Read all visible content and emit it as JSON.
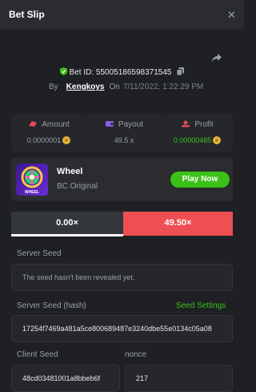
{
  "header": {
    "title": "Bet Slip",
    "close_icon": "close-icon"
  },
  "bet": {
    "id_label": "Bet ID: 5500518659837154​5",
    "by_label": "By",
    "username": "Kengkoys",
    "on_label": "On",
    "date": "7/11/2022, 1:22:29 PM"
  },
  "stats": [
    {
      "label": "Amount",
      "value": "0.0000001",
      "icon": "money-icon",
      "color": "#e24a5c"
    },
    {
      "label": "Payout",
      "value": "49.5 x",
      "icon": "wallet-icon",
      "color": "#8c5ce0"
    },
    {
      "label": "Profit",
      "value": "0.00000485",
      "icon": "profit-icon",
      "color": "#e24a5c"
    }
  ],
  "game": {
    "name": "Wheel",
    "subtitle": "BC Original",
    "play_label": "Play Now",
    "thumb_text": "WHEEL"
  },
  "multipliers": {
    "left": "0.00×",
    "right": "49.50×"
  },
  "seeds": {
    "server_seed_label": "Server Seed",
    "server_seed_placeholder": "The seed hasn't been revealed yet.",
    "server_hash_label": "Server Seed (hash)",
    "seed_settings_label": "Seed Settings",
    "server_hash_value": "17254f7469a481a5ce800689487e3240dbe55e0134c05a08",
    "client_seed_label": "Client Seed",
    "client_seed_value": "48cd03481001a8bbeb6f",
    "nonce_label": "nonce",
    "nonce_value": "217"
  },
  "colors": {
    "accent_green": "#3bc117",
    "accent_red": "#ed4f52",
    "coin": "#e4b33a"
  }
}
